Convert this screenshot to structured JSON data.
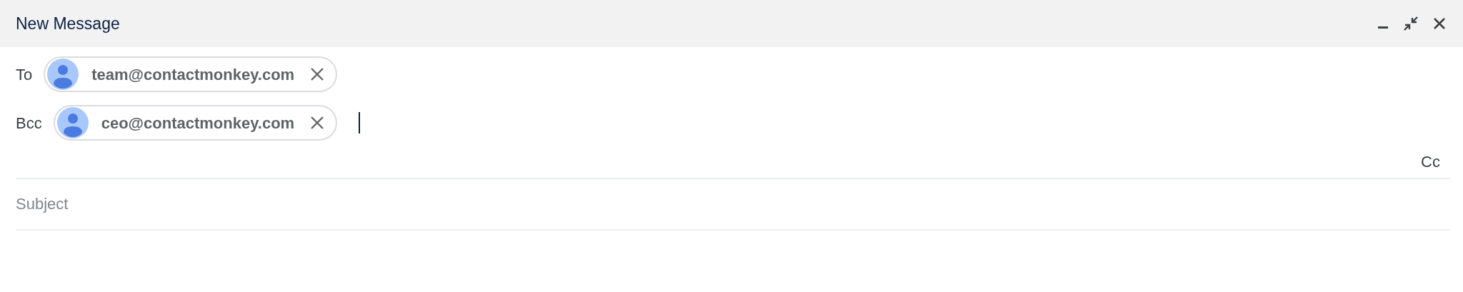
{
  "window": {
    "title": "New Message"
  },
  "recipients": [
    {
      "label": "To",
      "chips": [
        {
          "email": "team@contactmonkey.com"
        }
      ],
      "cursor": false
    },
    {
      "label": "Bcc",
      "chips": [
        {
          "email": "ceo@contactmonkey.com"
        }
      ],
      "cursor": true
    }
  ],
  "cc_link": "Cc",
  "subject": {
    "placeholder": "Subject"
  }
}
